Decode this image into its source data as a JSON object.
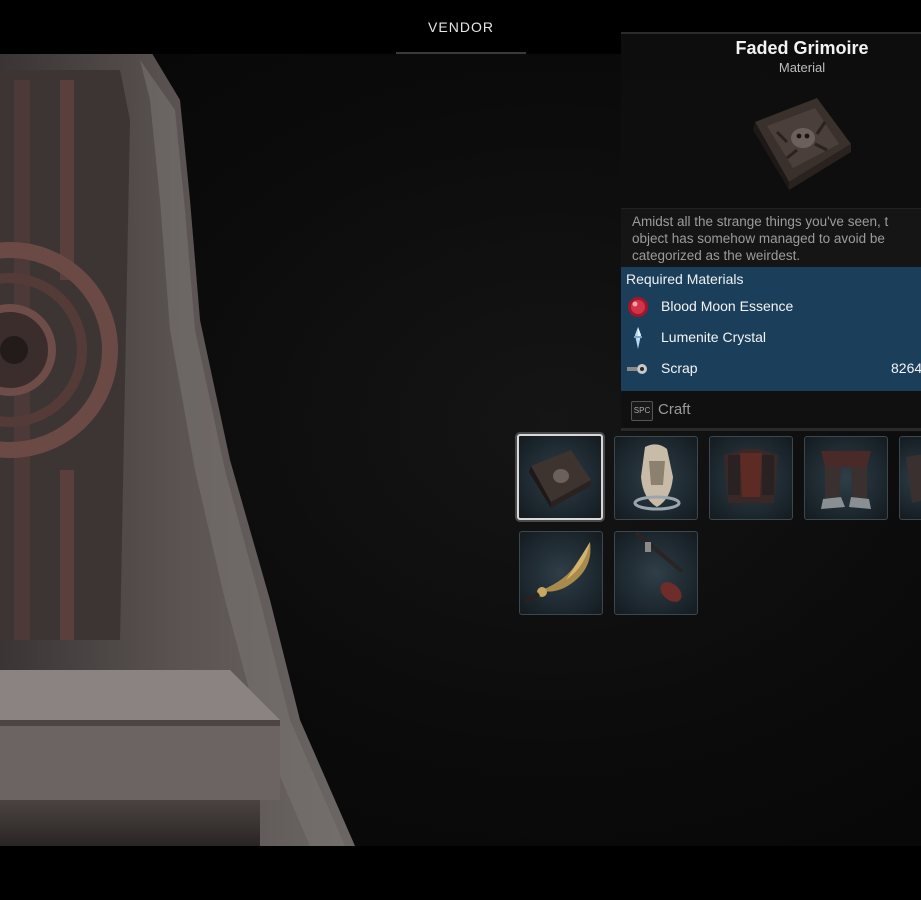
{
  "header": {
    "vendor_tab": "VENDOR"
  },
  "item": {
    "title": "Faded Grimoire",
    "type": "Material",
    "icon": "grimoire-icon",
    "description_lines": [
      "Amidst all the strange things you've seen, t",
      "object has somehow managed to avoid be",
      "categorized as the weirdest."
    ]
  },
  "required": {
    "header": "Required Materials",
    "items": [
      {
        "name": "Blood Moon Essence",
        "icon": "blood-moon-essence-icon",
        "count": ""
      },
      {
        "name": "Lumenite Crystal",
        "icon": "lumenite-crystal-icon",
        "count": ""
      },
      {
        "name": "Scrap",
        "icon": "scrap-icon",
        "count": "8264"
      }
    ]
  },
  "craft": {
    "key": "SPC",
    "label": "Craft"
  },
  "slots": [
    {
      "icon": "grimoire-icon",
      "selected": true
    },
    {
      "icon": "bone-helm-icon",
      "selected": false
    },
    {
      "icon": "chest-armor-icon",
      "selected": false
    },
    {
      "icon": "leg-armor-icon",
      "selected": false
    },
    {
      "icon": "partial-item-icon",
      "selected": false
    },
    {
      "icon": "curved-blade-icon",
      "selected": false
    },
    {
      "icon": "staff-icon",
      "selected": false
    }
  ],
  "colors": {
    "req_panel": "#1b3f5a",
    "slot_bg": "#1b252c",
    "selected_border": "#d9d9d9"
  }
}
